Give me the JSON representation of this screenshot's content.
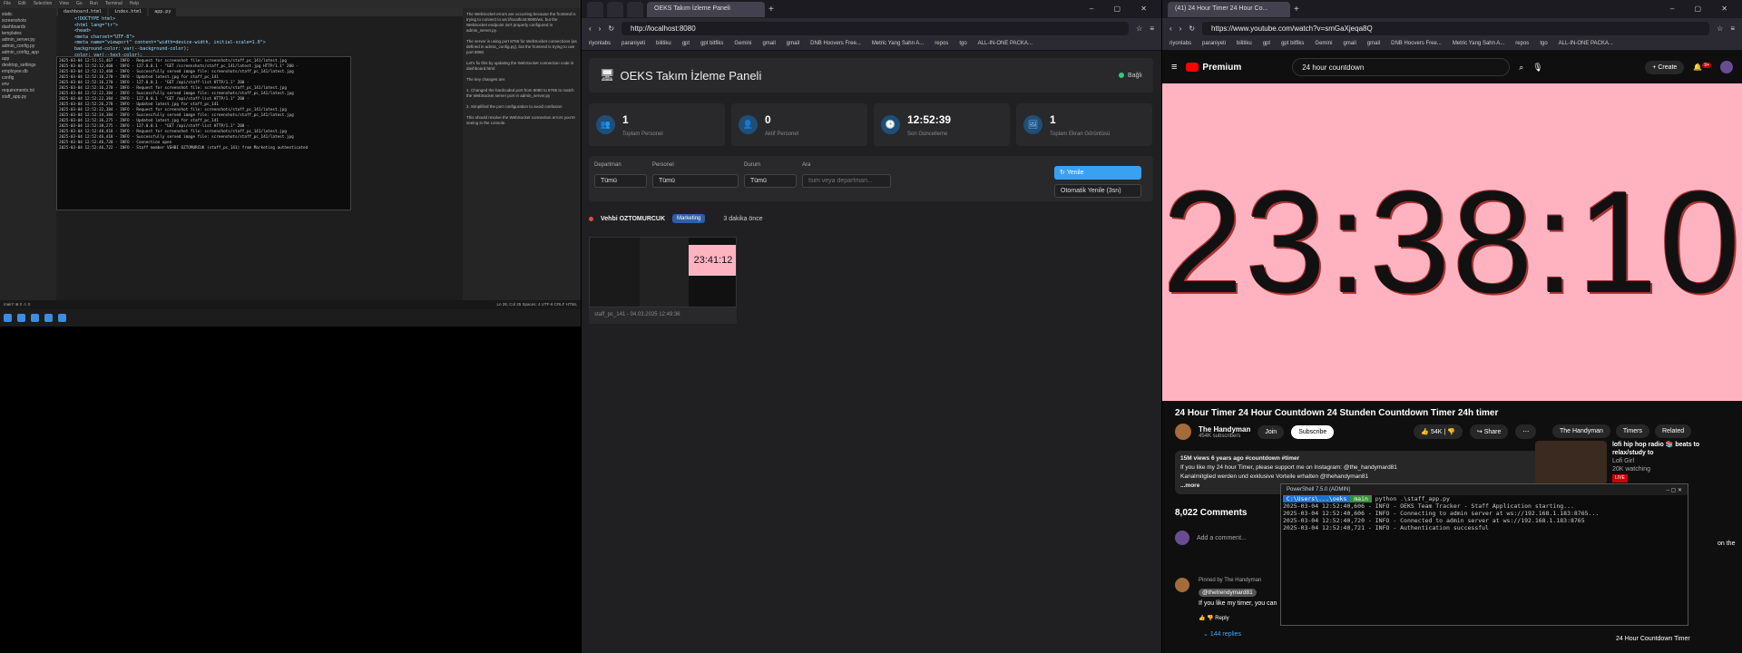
{
  "left_screen": {
    "menu": [
      "File",
      "Edit",
      "Selection",
      "View",
      "Go",
      "Run",
      "Terminal",
      "Help"
    ],
    "tabs": [
      "dashboard.html",
      "index.html",
      "app.py"
    ],
    "explorer": [
      "static",
      "screenshots",
      "dashboards",
      "templates",
      "admin_server.py",
      "admin_config.py",
      "admin_config_app",
      "app",
      "desktop_settings",
      "employee.db",
      "config",
      "env",
      "requirements.txt",
      "staff_app.py"
    ],
    "code": [
      "<!DOCTYPE html>",
      "<html lang=\"tr\">",
      "<head>",
      "<meta charset=\"UTF-8\">",
      "<meta name=\"viewport\" content=\"width=device-width, initial-scale=1.0\">",
      "background-color: var(--background-color);",
      "color: var(--text-color);",
      "line-height: 1.6;",
      "}",
      ".container {",
      "max-width: 1400px;",
      "margin: 0 auto;",
      "padding: 2rem;",
      "}",
      "/* Header Styles */",
      ".header {",
      "display: flex;",
      "justify-content: space-between;",
      "align-items: center;"
    ],
    "terminal": [
      "2025-03-04 12:51:51,467 - INFO - Request for screenshot file: screenshots/staff_pc_141/latest.jpg",
      "2025-03-04 12:52:12,468 - INFO - 127.0.0.1 - \"GET /screenshots/staff_pc_141/latest.jpg HTTP/1.1\" 200 -",
      "2025-03-04 12:52:12,468 - INFO - Successfully served image file: screenshots/staff_pc_141/latest.jpg",
      "2025-03-04 12:52:16,270 - INFO - Updated latest.jpg for staff_pc_141",
      "2025-03-04 12:52:16,270 - INFO - 127.0.0.1 - \"GET /api/staff-list HTTP/1.1\" 200 -",
      "2025-03-04 12:52:16,270 - INFO - Request for screenshot file: screenshots/staff_pc_141/latest.jpg",
      "2025-03-04 12:52:22,384 - INFO - Successfully served image file: screenshots/staff_pc_141/latest.jpg",
      "2025-03-04 12:52:22,384 - INFO - 127.0.0.1 - \"GET /api/staff-list HTTP/1.1\" 200 -",
      "2025-03-04 12:52:26,278 - INFO - Updated latest.jpg for staff_pc_141",
      "2025-03-04 12:52:32,384 - INFO - Request for screenshot file: screenshots/staff_pc_141/latest.jpg",
      "2025-03-04 12:52:34,384 - INFO - Successfully served image file: screenshots/staff_pc_141/latest.jpg",
      "2025-03-04 12:52:36,275 - INFO - Updated latest.jpg for staff_pc_141",
      "2025-03-04 12:52:38,275 - INFO - 127.0.0.1 - \"GET /api/staff-list HTTP/1.1\" 200 -",
      "2025-03-04 12:52:40,418 - INFO - Request for screenshot file: screenshots/staff_pc_141/latest.jpg",
      "2025-03-04 12:52:46,418 - INFO - Successfully served image file: screenshots/staff_pc_141/latest.jpg",
      "2025-03-04 12:52:46,720 - INFO - Connection open",
      "2025-03-04 12:52:46,722 - INFO - Staff member VEHBI OZTOMURCUK (staff_pc_141) from Marketing authenticated"
    ],
    "chat": [
      "The WebSocket errors are occurring because the frontend is trying to connect to ws://localhost:8080/ws, but the WebSocket endpoint isn't properly configured in admin_server.py.",
      "The server is using port 8765 for WebSocket connections (as defined in admin_config.py), but the frontend is trying to use port 8080.",
      "Let's fix this by updating the WebSocket connection code in dashboard.html:",
      "The key changes are:",
      "1. Changed the hardcoded port from 8080 to 8765 to match the WebSocket server port in admin_server.py",
      "2. Simplified the port configuration to avoid confusion",
      "This should resolve the WebSocket connection errors you're seeing in the console."
    ],
    "status_left": "main* ⊗ 0 ⚠ 0",
    "status_right": "Ln 28, Col 25  Spaces: 4  UTF-8  CRLF  HTML"
  },
  "oeks_browser": {
    "tab_title": "OEKS Takım İzleme Paneli",
    "url": "http://localhost:8080",
    "bookmarks": [
      "riyonlabs",
      "paraniyeti",
      "bilitiku",
      "gpt",
      "gpt bitfiks",
      "Gemini",
      "gmail",
      "gmail",
      "DNB Hoovers Free...",
      "Metric Yang Sahn A...",
      "repos",
      "tgo",
      "ALL-IN-ONE PACKA..."
    ],
    "title": "OEKS Takım İzleme Paneli",
    "connection_status": "Bağlı",
    "stats": [
      {
        "value": "1",
        "label": "Toplam Personel",
        "icon": "users-icon"
      },
      {
        "value": "0",
        "label": "Aktif Personel",
        "icon": "user-icon"
      },
      {
        "value": "12:52:39",
        "label": "Son Güncelleme",
        "icon": "clock-icon"
      },
      {
        "value": "1",
        "label": "Toplam Ekran Görüntüsü",
        "icon": "image-icon"
      }
    ],
    "filters": {
      "department_label": "Departman",
      "department_value": "Tümü",
      "staff_label": "Personel",
      "staff_value": "Tümü",
      "status_label": "Durum",
      "status_value": "Tümü",
      "search_label": "Ara",
      "search_placeholder": "İsim veya departman...",
      "refresh_button": "Yenile",
      "auto_refresh": "Otomatik Yenile (3sn)"
    },
    "staff": {
      "name": "Vehbi OZTOMURCUK",
      "department": "Marketing",
      "last_seen": "3 dakika önce",
      "thumb_time": "23:41:12",
      "caption": "staff_pc_141 - 04.03.2025 12:49:36"
    }
  },
  "yt_browser": {
    "tab_title": "(41) 24 Hour Timer 24 Hour Co...",
    "url": "https://www.youtube.com/watch?v=smGaXjeqa8Q",
    "bookmarks": [
      "riyonlabs",
      "paraniyeti",
      "bilitiku",
      "gpt",
      "gpt bitfiks",
      "Gemini",
      "gmail",
      "gmail",
      "DNB Hoovers Free...",
      "Metric Yang Sahn A...",
      "repos",
      "tgo",
      "ALL-IN-ONE PACKA..."
    ],
    "logo": "Premium",
    "search": "24 hour countdown",
    "create": "Create",
    "notif_count": "9+",
    "timer": "23:38:10",
    "video_title": "24 Hour Timer 24 Hour Countdown 24 Stunden Countdown Timer 24h timer",
    "channel": "The Handyman",
    "subscribers": "454K subscribers",
    "join": "Join",
    "subscribe": "Subscribe",
    "likes": "54K",
    "share": "Share",
    "views_line": "15M views  6 years ago  #countdown #timer",
    "desc_line1": "If you like my 24 hour Timer, please support me on Instagram: @the_handymard81",
    "desc_line2": "Kanalmitglied werden und exklusive Vorteile erhalten @thehandyman81",
    "more": "...more",
    "comments_count": "8,022 Comments",
    "add_comment": "Add a comment...",
    "pinned": "Pinned by The Handyman",
    "comment_author": "@thetrendymard81",
    "comment_text": "If you like my timer, you can",
    "reply": "Reply",
    "replies": "144 replies",
    "chips": [
      "The Handyman",
      "Timers",
      "Related"
    ],
    "rec_title": "lofi hip hop radio 📚 beats to relax/study to",
    "rec_channel": "Lofi Girl",
    "rec_watching": "20K watching",
    "rec_live": "LIVE",
    "rec2_title": "24 Hour Countdown Timer",
    "side_clip": "on the"
  },
  "powershell": {
    "title": "PowerShell 7.5.0 (ADMIN)",
    "prompt": "python .\\staff_app.py",
    "lines": [
      "2025-03-04 12:52:40,606 - INFO - OEKS Team Tracker - Staff Application starting...",
      "2025-03-04 12:52:40,606 - INFO - Connecting to admin server at ws://192.168.1.183:8765...",
      "2025-03-04 12:52:40,720 - INFO - Connected to admin server at ws://192.168.1.183:8765",
      "2025-03-04 12:52:40,721 - INFO - Authentication successful"
    ]
  }
}
